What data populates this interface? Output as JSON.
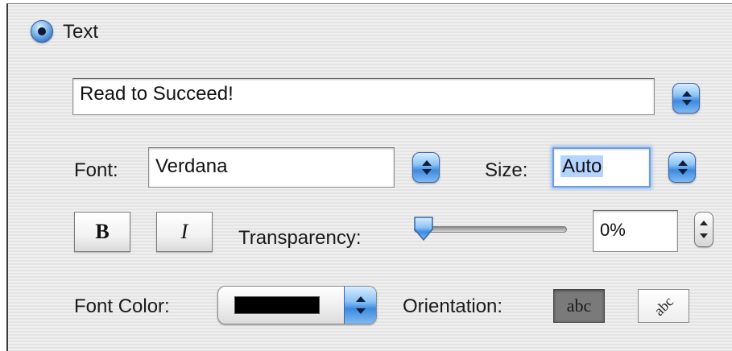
{
  "text_option": {
    "label": "Text",
    "selected": true
  },
  "text_field": {
    "value": "Read to Succeed!"
  },
  "font": {
    "label": "Font:",
    "value": "Verdana"
  },
  "size": {
    "label": "Size:",
    "value": "Auto"
  },
  "format_buttons": {
    "bold": "B",
    "italic": "I"
  },
  "transparency": {
    "label": "Transparency:",
    "value": "0%",
    "level": 0
  },
  "font_color": {
    "label": "Font Color:",
    "color": "#000000"
  },
  "orientation": {
    "label": "Orientation:",
    "horizontal": "abc",
    "diagonal": "abc"
  },
  "icons": {
    "radio": "radio-selected-icon",
    "popup": "popup-arrows-icon",
    "stepper": "stepper-arrows-icon"
  }
}
